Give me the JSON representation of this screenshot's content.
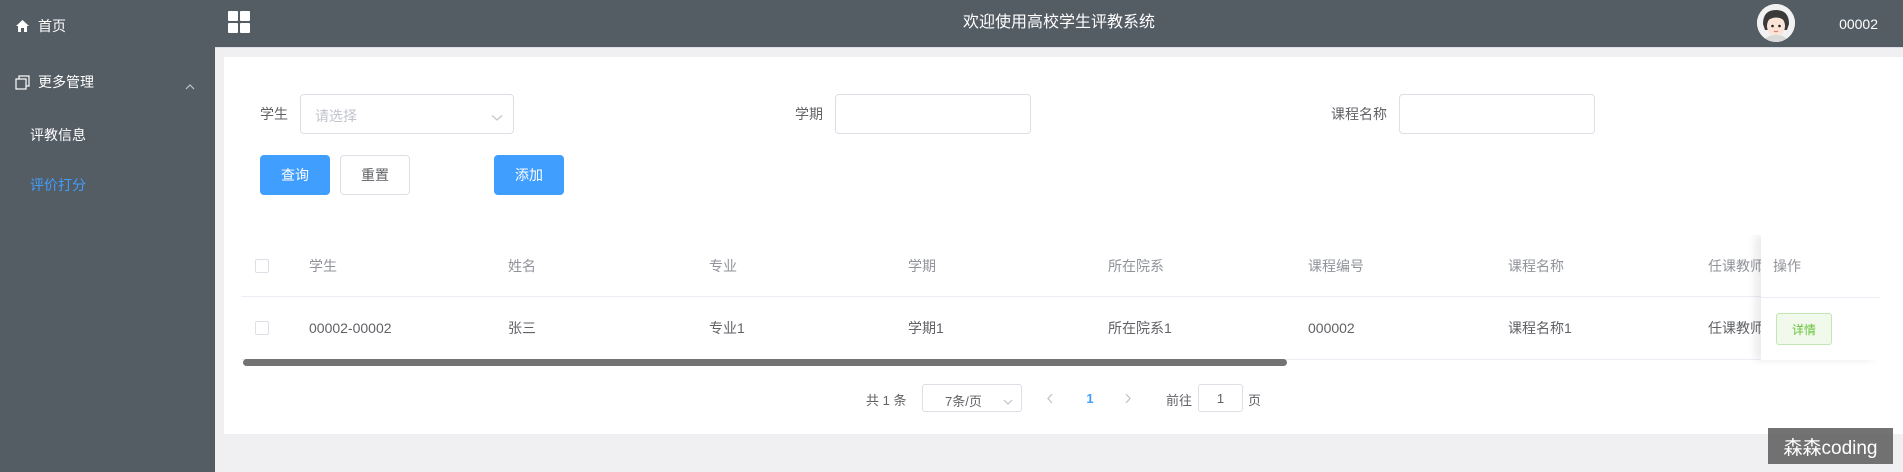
{
  "sidebar": {
    "items": [
      {
        "label": "首页",
        "icon": "home-icon"
      },
      {
        "label": "更多管理",
        "icon": "copy-icon"
      },
      {
        "label": "评教信息"
      },
      {
        "label": "评价打分",
        "active": true
      }
    ]
  },
  "header": {
    "title": "欢迎使用高校学生评教系统",
    "user": "00002"
  },
  "search": {
    "student_label": "学生",
    "student_placeholder": "请选择",
    "semester_label": "学期",
    "course_label": "课程名称"
  },
  "buttons": {
    "query": "查询",
    "reset": "重置",
    "add": "添加"
  },
  "table": {
    "columns": [
      "学生",
      "姓名",
      "专业",
      "学期",
      "所在院系",
      "课程编号",
      "课程名称",
      "任课教师",
      "操作"
    ],
    "rows": [
      {
        "student": "00002-00002",
        "name": "张三",
        "major": "专业1",
        "semester": "学期1",
        "department": "所在院系1",
        "course_no": "000002",
        "course_name": "课程名称1",
        "teacher": "任课教师",
        "action": "详情"
      }
    ]
  },
  "pagination": {
    "total": "共 1 条",
    "page_size": "7条/页",
    "current_page": "1",
    "goto_prefix": "前往",
    "goto_value": "1",
    "goto_suffix": "页"
  },
  "watermark": "森森coding",
  "colors": {
    "sidebar_bg": "#545c64",
    "primary": "#409eff",
    "success": "#67c23a"
  }
}
